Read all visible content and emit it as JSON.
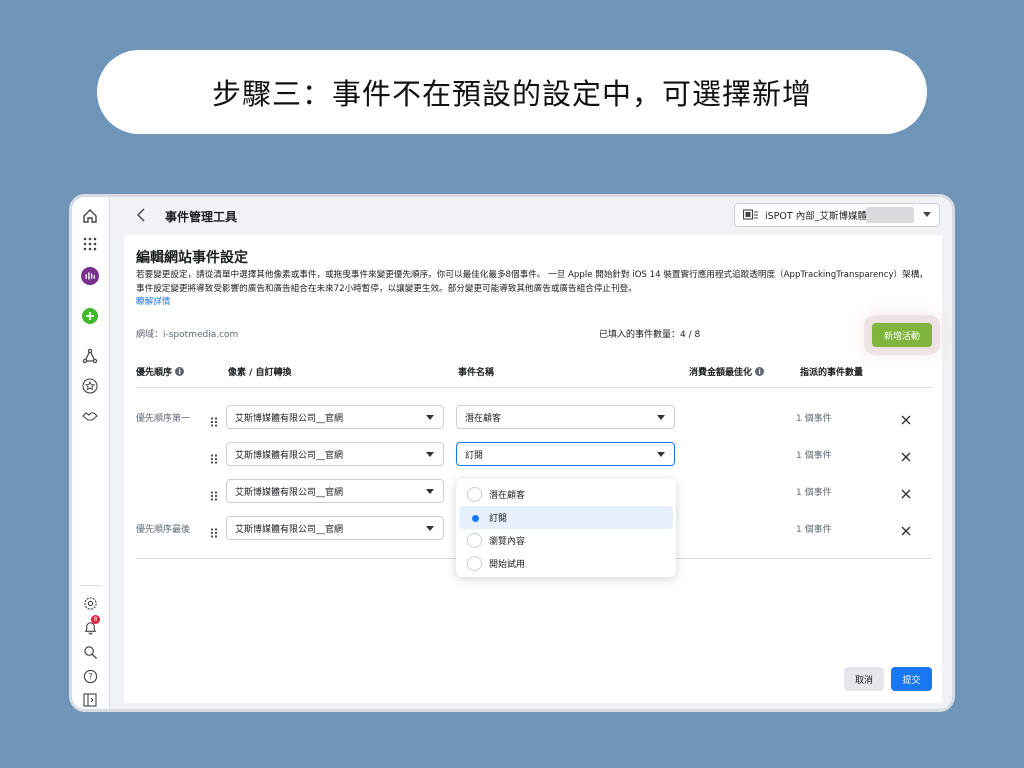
{
  "banner": {
    "text": "步驟三：事件不在預設的設定中，可選擇新增"
  },
  "topbar": {
    "title": "事件管理工具",
    "account": "iSPOT 內部_艾斯博媒體"
  },
  "page": {
    "title": "編輯網站事件設定",
    "description": "若要變更設定，請從清單中選擇其他像素或事件，或拖曳事件來變更優先順序。你可以最佳化最多8個事件。 一旦 Apple 開始針對 iOS 14 裝置實行應用程式追蹤透明度（AppTrackingTransparency）架構，事件設定變更將導致受影響的廣告和廣告組合在未來72小時暫停，以讓變更生效。部分變更可能導致其他廣告或廣告組合停止刊登。",
    "learn_more": "瞭解詳情",
    "domain": "網域：i-spotmedia.com",
    "filled_count": "已填入的事件數量：4 / 8",
    "add_button": "新增活動"
  },
  "table": {
    "headers": {
      "priority": "優先順序",
      "pixel": "像素 / 自訂轉換",
      "event": "事件名稱",
      "value_opt": "消費金額最佳化",
      "assigned": "指派的事件數量"
    },
    "rows": [
      {
        "label": "優先順序第一",
        "pixel": "艾斯博媒體有限公司__官網",
        "event": "潛在顧客",
        "count": "1 個事件"
      },
      {
        "label": "",
        "pixel": "艾斯博媒體有限公司__官網",
        "event": "訂閱",
        "count": "1 個事件"
      },
      {
        "label": "",
        "pixel": "艾斯博媒體有限公司__官網",
        "event": "",
        "count": "1 個事件"
      },
      {
        "label": "優先順序最後",
        "pixel": "艾斯博媒體有限公司__官網",
        "event": "",
        "count": "1 個事件"
      }
    ]
  },
  "dropdown": {
    "options": [
      "潛在顧客",
      "訂閱",
      "瀏覽內容",
      "開始試用"
    ],
    "selected": "訂閱"
  },
  "footer": {
    "cancel": "取消",
    "submit": "提交"
  },
  "rail": {
    "notification_badge": "8"
  },
  "colors": {
    "accent": "#1877f2",
    "add_button": "#7fb53c",
    "background": "#6f95b9"
  }
}
